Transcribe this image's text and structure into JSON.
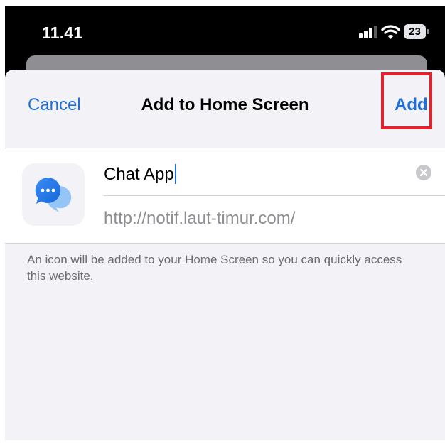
{
  "status_bar": {
    "time": "11.41",
    "battery_level": "23",
    "cell_signal_icon": "cell-signal-icon",
    "wifi_icon": "wifi-icon",
    "battery_icon": "battery-icon"
  },
  "sheet": {
    "cancel_label": "Cancel",
    "title": "Add to Home Screen",
    "add_label": "Add",
    "highlight_color": "#e0242f",
    "accent_color": "#1f6fd6"
  },
  "form": {
    "app_icon": "chat-bubbles-icon",
    "name_value": "Chat App",
    "clear_icon": "clear-circle-icon",
    "url": "http://notif.laut-timur.com/"
  },
  "footnote": "An icon will be added to your Home Screen so you can quickly access this website."
}
